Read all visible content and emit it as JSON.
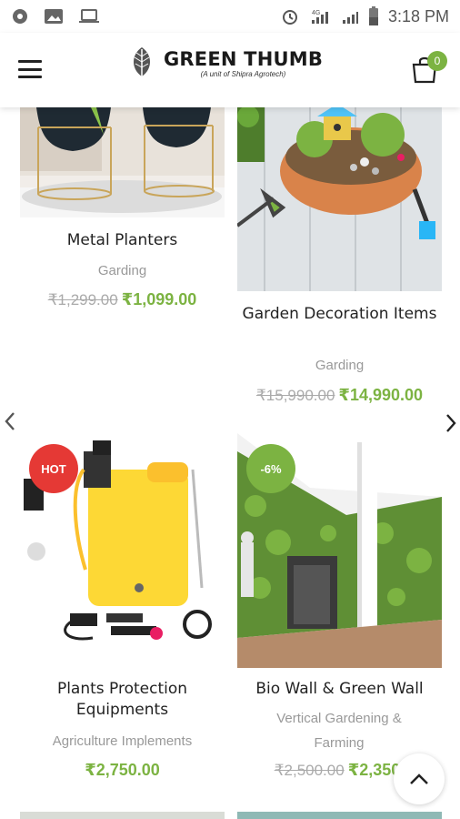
{
  "status_bar": {
    "time": "3:18 PM",
    "network": "4G"
  },
  "header": {
    "brand_name": "GREEN THUMB",
    "brand_sub": "(A unit of Shipra Agrotech)",
    "cart_count": "0"
  },
  "products": [
    {
      "title": "Metal Planters",
      "category": "Garding",
      "old_price": "₹1,299.00",
      "price": "₹1,099.00",
      "badge": ""
    },
    {
      "title": "Garden Decoration Items",
      "category": "Garding",
      "old_price": "₹15,990.00",
      "price": "₹14,990.00",
      "badge": ""
    },
    {
      "title": "Plants Protection Equipments",
      "category": "Agriculture Implements",
      "old_price": "",
      "price": "₹2,750.00",
      "badge": "HOT"
    },
    {
      "title": "Bio Wall & Green Wall",
      "category": "Vertical Gardening & Farming",
      "old_price": "₹2,500.00",
      "price": "₹2,350.",
      "badge": "-6%"
    }
  ],
  "colors": {
    "accent": "#7cb342",
    "hot_badge": "#e53935",
    "old_price": "#aaaaaa",
    "category": "#999999"
  },
  "icons": {
    "menu": "hamburger-icon",
    "cart": "shopping-bag-icon",
    "prev": "chevron-left-icon",
    "next": "chevron-right-icon",
    "scroll_top": "chevron-up-icon"
  }
}
